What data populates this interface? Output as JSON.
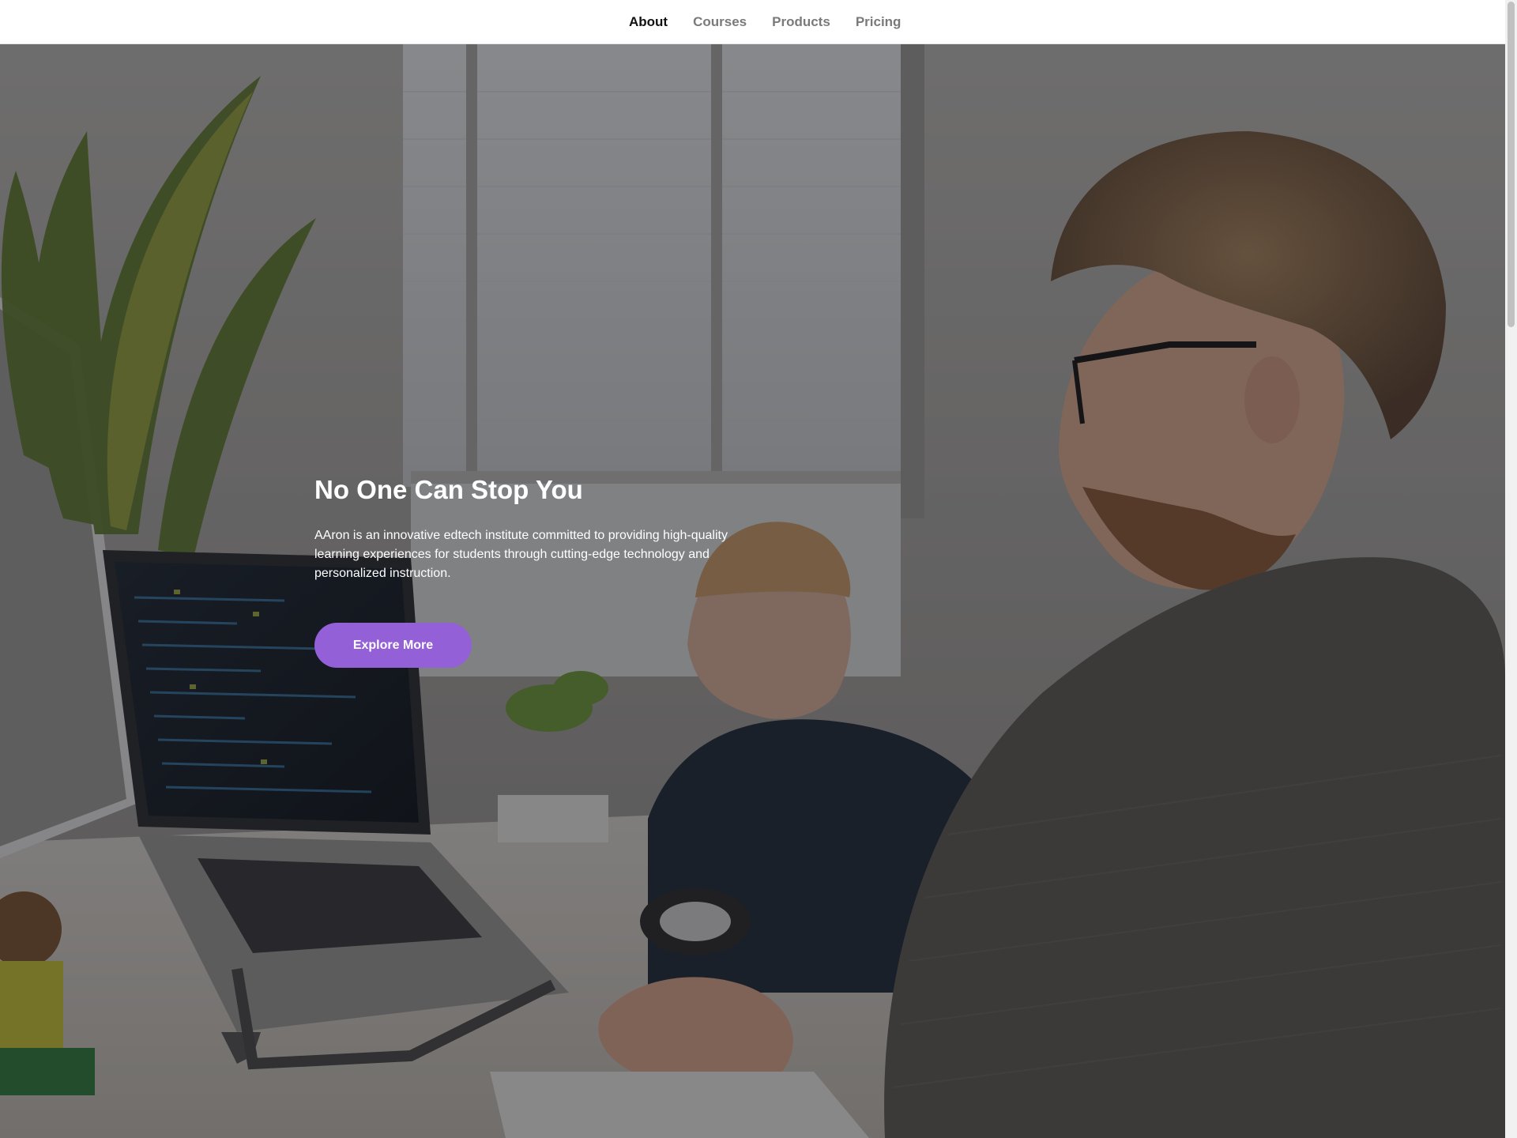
{
  "nav": {
    "items": [
      {
        "label": "About",
        "active": true
      },
      {
        "label": "Courses",
        "active": false
      },
      {
        "label": "Products",
        "active": false
      },
      {
        "label": "Pricing",
        "active": false
      }
    ]
  },
  "hero": {
    "title": "No One Can Stop You",
    "description": "AAron is an innovative edtech institute committed to providing high-quality learning experiences for students through cutting-edge technology and personalized instruction.",
    "cta_label": "Explore More",
    "background_image": "office-developers-photo"
  },
  "colors": {
    "accent": "#9460d8",
    "nav_active": "#111111",
    "nav_inactive": "#7a7a7a",
    "overlay": "rgba(20,20,24,0.45)"
  }
}
